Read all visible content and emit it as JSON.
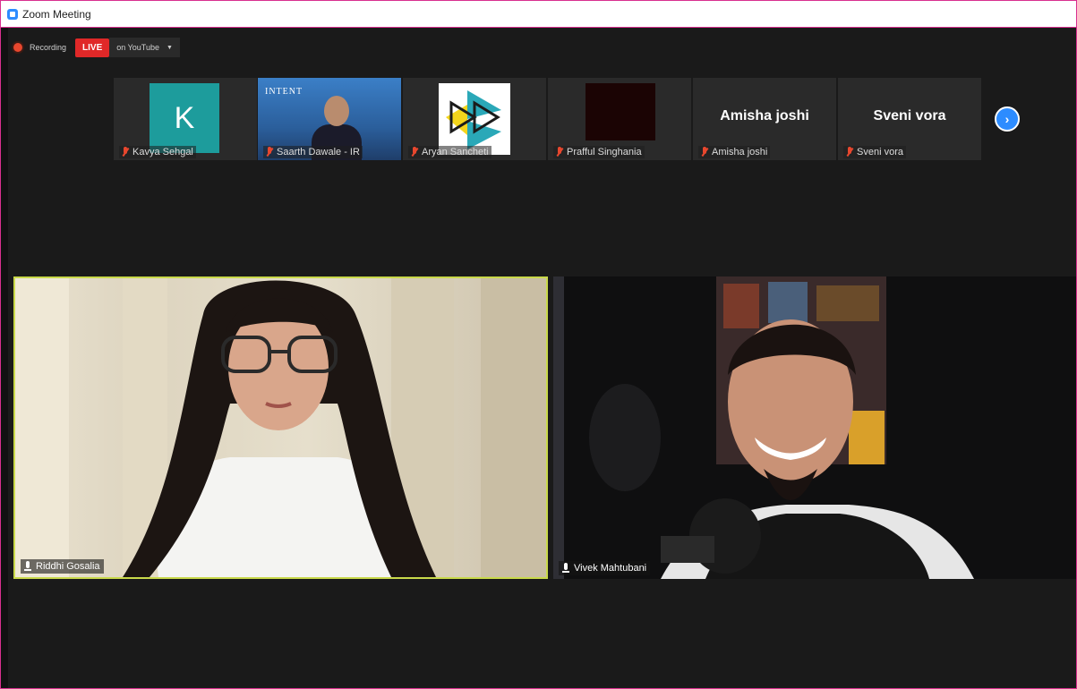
{
  "window": {
    "title": "Zoom Meeting"
  },
  "recording": {
    "status_label": "Recording",
    "live_label": "LIVE",
    "destination_label": "on YouTube",
    "dropdown_icon": "chevron-down-icon"
  },
  "thumbnails": [
    {
      "name": "Kavya Sehgal",
      "avatar_letter": "K",
      "muted": true
    },
    {
      "name": "Saarth Dawale - IR",
      "background_text": "INTENT",
      "muted": true
    },
    {
      "name": "Aryan Sancheti",
      "muted": true
    },
    {
      "name": "Prafful Singhania",
      "muted": true
    },
    {
      "name": "Amisha joshi",
      "display_name": "Amisha joshi",
      "muted": true
    },
    {
      "name": "Sveni vora",
      "display_name": "Sveni vora",
      "muted": true
    }
  ],
  "next_page_icon": "chevron-right-icon",
  "speakers": [
    {
      "name": "Riddhi Gosalia",
      "muted": false
    },
    {
      "name": "Vivek Mahtubani",
      "muted": false
    }
  ],
  "colors": {
    "accent": "#2d8cff",
    "live": "#e02828",
    "active_speaker_border": "#c9d94a",
    "window_border": "#d9308f"
  }
}
